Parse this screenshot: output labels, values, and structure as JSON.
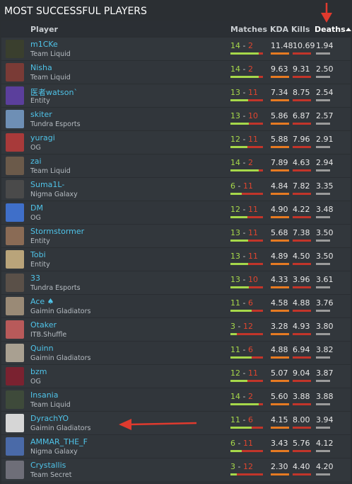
{
  "title": "MOST SUCCESSFUL PLAYERS",
  "headers": {
    "player": "Player",
    "matches": "Matches",
    "kda": "KDA",
    "kills": "Kills",
    "deaths": "Deaths"
  },
  "colors": {
    "accent_name": "#4fc3e8",
    "win": "#a6d84a",
    "loss": "#e0452f",
    "kda_bar": "#e67a22",
    "annotation_red": "#e03a2e"
  },
  "players": [
    {
      "name": "m1CKe",
      "team": "Team Liquid",
      "wins": "14",
      "losses": "2",
      "kda": "11.48",
      "kills": "10.69",
      "deaths": "1.94",
      "avatar": "#3a3f2e"
    },
    {
      "name": "Nisha",
      "team": "Team Liquid",
      "wins": "14",
      "losses": "2",
      "kda": "9.63",
      "kills": "9.31",
      "deaths": "2.50",
      "avatar": "#7a3b36"
    },
    {
      "name": "医者watson`",
      "team": "Entity",
      "wins": "13",
      "losses": "11",
      "kda": "7.34",
      "kills": "8.75",
      "deaths": "2.54",
      "avatar": "#5b3f9c"
    },
    {
      "name": "skiter",
      "team": "Tundra Esports",
      "wins": "13",
      "losses": "10",
      "kda": "5.86",
      "kills": "6.87",
      "deaths": "2.57",
      "avatar": "#6e8fb5"
    },
    {
      "name": "yuragi",
      "team": "OG",
      "wins": "12",
      "losses": "11",
      "kda": "5.88",
      "kills": "7.96",
      "deaths": "2.91",
      "avatar": "#a83a3a"
    },
    {
      "name": "zai",
      "team": "Team Liquid",
      "wins": "14",
      "losses": "2",
      "kda": "7.89",
      "kills": "4.63",
      "deaths": "2.94",
      "avatar": "#6b5a4a"
    },
    {
      "name": "Suma1L-",
      "team": "Nigma Galaxy",
      "wins": "6",
      "losses": "11",
      "kda": "4.84",
      "kills": "7.82",
      "deaths": "3.35",
      "avatar": "#4a4a4a"
    },
    {
      "name": "DM",
      "team": "OG",
      "wins": "12",
      "losses": "11",
      "kda": "4.90",
      "kills": "4.22",
      "deaths": "3.48",
      "avatar": "#3f6fc9"
    },
    {
      "name": "Stormstormer",
      "team": "Entity",
      "wins": "13",
      "losses": "11",
      "kda": "5.68",
      "kills": "7.38",
      "deaths": "3.50",
      "avatar": "#8a6b55"
    },
    {
      "name": "Tobi",
      "team": "Entity",
      "wins": "13",
      "losses": "11",
      "kda": "4.89",
      "kills": "4.50",
      "deaths": "3.50",
      "avatar": "#b9a47a"
    },
    {
      "name": "33",
      "team": "Tundra Esports",
      "wins": "13",
      "losses": "10",
      "kda": "4.33",
      "kills": "3.96",
      "deaths": "3.61",
      "avatar": "#5a5048"
    },
    {
      "name": "Ace ♠",
      "team": "Gaimin Gladiators",
      "wins": "11",
      "losses": "6",
      "kda": "4.58",
      "kills": "4.88",
      "deaths": "3.76",
      "avatar": "#9a8a76"
    },
    {
      "name": "Otaker",
      "team": "ITB.Shuffle",
      "wins": "3",
      "losses": "12",
      "kda": "3.28",
      "kills": "4.93",
      "deaths": "3.80",
      "avatar": "#b85a5a"
    },
    {
      "name": "Quinn",
      "team": "Gaimin Gladiators",
      "wins": "11",
      "losses": "6",
      "kda": "4.88",
      "kills": "6.94",
      "deaths": "3.82",
      "avatar": "#a9a091"
    },
    {
      "name": "bzm",
      "team": "OG",
      "wins": "12",
      "losses": "11",
      "kda": "5.07",
      "kills": "9.04",
      "deaths": "3.87",
      "avatar": "#7a2230"
    },
    {
      "name": "Insania",
      "team": "Team Liquid",
      "wins": "14",
      "losses": "2",
      "kda": "5.60",
      "kills": "3.88",
      "deaths": "3.88",
      "avatar": "#3e4a3a"
    },
    {
      "name": "DyrachYO",
      "team": "Gaimin Gladiators",
      "wins": "11",
      "losses": "6",
      "kda": "4.15",
      "kills": "8.00",
      "deaths": "3.94",
      "avatar": "#d6d6d6"
    },
    {
      "name": "AMMAR_THE_F",
      "team": "Nigma Galaxy",
      "wins": "6",
      "losses": "11",
      "kda": "3.43",
      "kills": "5.76",
      "deaths": "4.12",
      "avatar": "#4a6aa8"
    },
    {
      "name": "Crystallis",
      "team": "Team Secret",
      "wins": "3",
      "losses": "12",
      "kda": "2.30",
      "kills": "4.40",
      "deaths": "4.20",
      "avatar": "#6e6e78"
    }
  ]
}
